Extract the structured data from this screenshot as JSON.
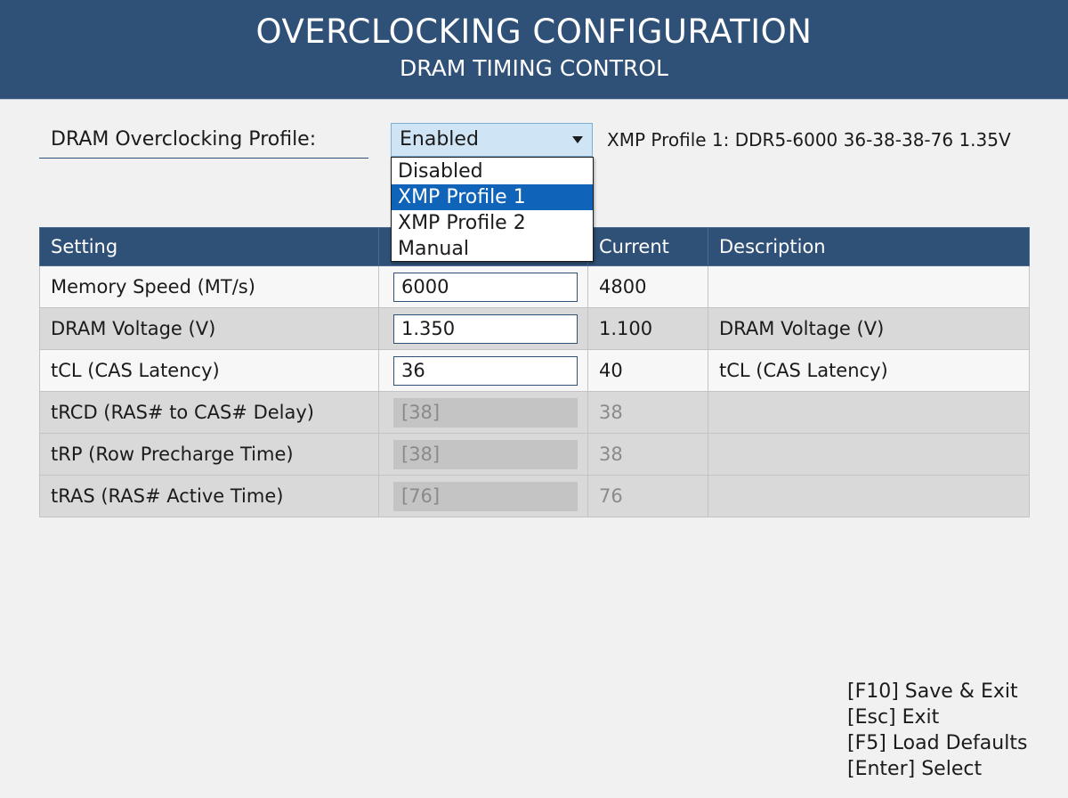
{
  "header": {
    "title": "OVERCLOCKING CONFIGURATION",
    "subtitle": "DRAM TIMING CONTROL"
  },
  "profile": {
    "label": "DRAM Overclocking Profile:",
    "selected_value": "Enabled",
    "info": "XMP Profile 1: DDR5-6000 36-38-38-76 1.35V",
    "dropdown_options": [
      "Disabled",
      "XMP Profile 1",
      "XMP Profile 2",
      "Manual"
    ],
    "highlighted_option": "XMP Profile 1"
  },
  "table": {
    "columns": [
      "Setting",
      "",
      "Current",
      "Description"
    ],
    "rows": [
      {
        "setting": "Memory Speed (MT/s)",
        "value": "6000",
        "current": "4800",
        "description": "",
        "editable": true
      },
      {
        "setting": "DRAM Voltage (V)",
        "value": "1.350",
        "current": "1.100",
        "description": "DRAM Voltage (V)",
        "editable": true
      },
      {
        "setting": "tCL (CAS Latency)",
        "value": "36",
        "current": "40",
        "description": "tCL (CAS Latency)",
        "editable": true
      },
      {
        "setting": "tRCD (RAS# to CAS# Delay)",
        "value": "[38]",
        "current": "38",
        "description": "",
        "editable": false
      },
      {
        "setting": "tRP (Row Precharge Time)",
        "value": "[38]",
        "current": "38",
        "description": "",
        "editable": false
      },
      {
        "setting": "tRAS (RAS# Active Time)",
        "value": "[76]",
        "current": "76",
        "description": "",
        "editable": false
      }
    ]
  },
  "footer_keys": [
    "[F10] Save & Exit",
    "[Esc] Exit",
    "[F5] Load Defaults",
    "[Enter] Select"
  ],
  "colors": {
    "header": "#2f5077",
    "highlight": "#0f63b8",
    "select_bg": "#cfe4f4"
  }
}
